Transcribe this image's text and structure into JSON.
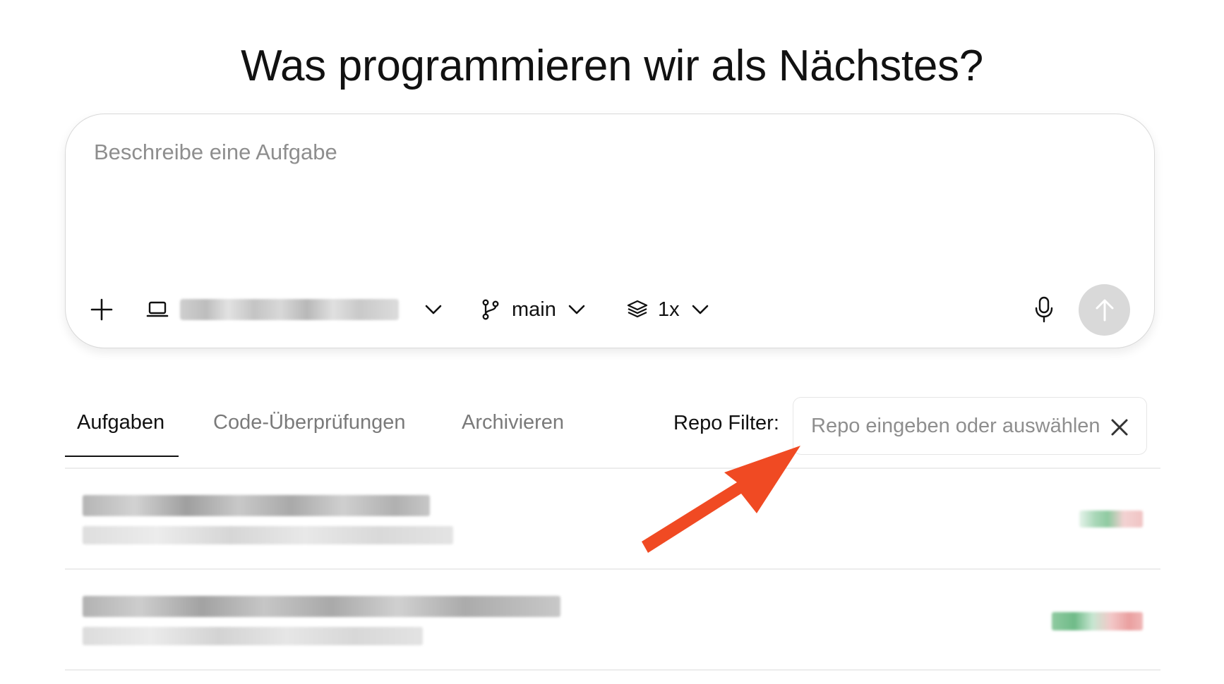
{
  "heading": "Was programmieren wir als Nächstes?",
  "composer": {
    "placeholder": "Beschreibe eine Aufgabe",
    "branch": "main",
    "versions": "1x"
  },
  "tabs": [
    {
      "label": "Aufgaben",
      "active": true
    },
    {
      "label": "Code-Überprüfungen",
      "active": false
    },
    {
      "label": "Archivieren",
      "active": false
    }
  ],
  "repo_filter": {
    "label": "Repo Filter:",
    "placeholder": "Repo eingeben oder auswählen..."
  },
  "colors": {
    "annotation_arrow": "#f04a23",
    "send_button": "#d9d9d9",
    "diff_added": "#3fae6a",
    "diff_removed": "#e57c7c"
  }
}
